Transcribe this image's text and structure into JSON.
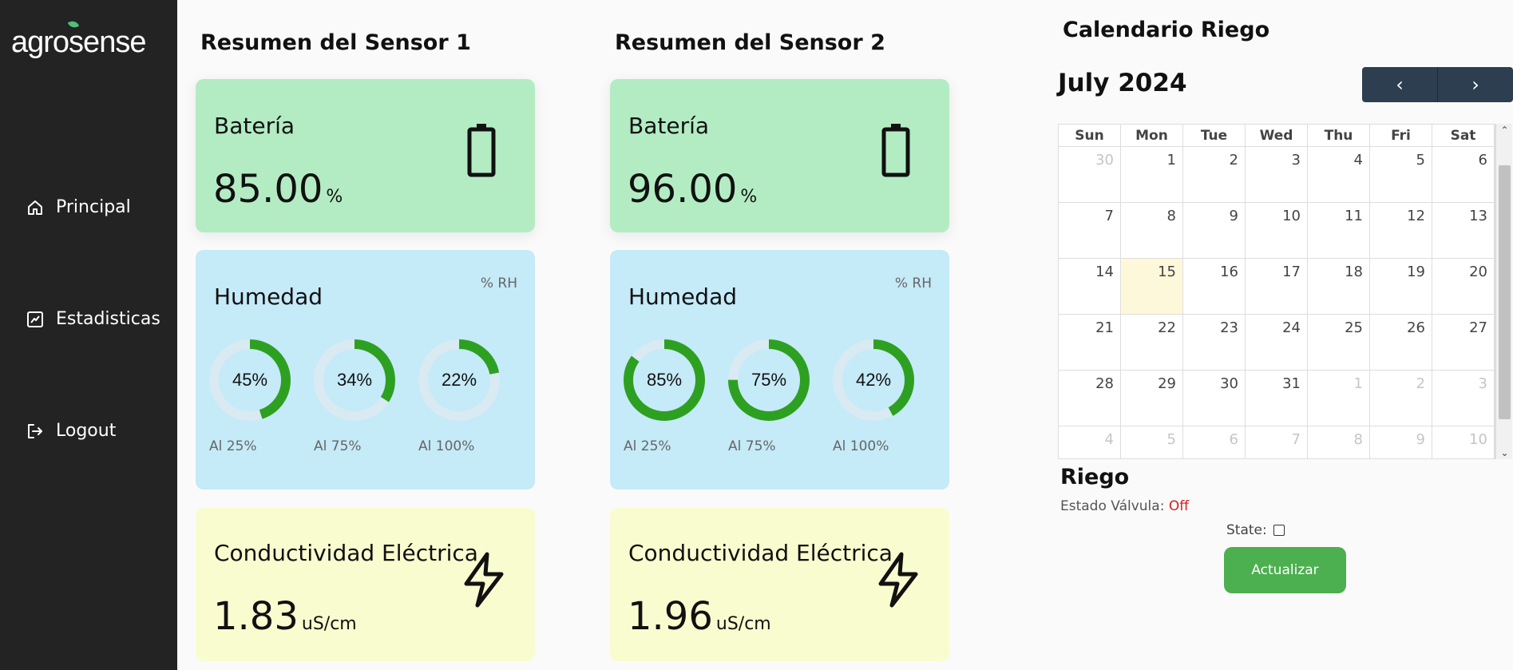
{
  "app": {
    "logo_text": "agrosense"
  },
  "sidebar": {
    "items": [
      {
        "label": "Principal",
        "icon": "home-icon"
      },
      {
        "label": "Estadisticas",
        "icon": "chart-icon"
      },
      {
        "label": "Logout",
        "icon": "logout-icon"
      }
    ]
  },
  "sensors": [
    {
      "title": "Resumen del Sensor 1",
      "battery": {
        "label": "Batería",
        "value": "85.00",
        "unit": "%"
      },
      "humidity": {
        "label": "Humedad",
        "unit": "% RH",
        "gauges": [
          {
            "percent": 45,
            "text": "45%",
            "caption": "Al 25%"
          },
          {
            "percent": 34,
            "text": "34%",
            "caption": "Al 75%"
          },
          {
            "percent": 22,
            "text": "22%",
            "caption": "Al 100%"
          }
        ]
      },
      "conductivity": {
        "label": "Conductividad Eléctrica",
        "value": "1.83",
        "unit": "uS/cm"
      }
    },
    {
      "title": "Resumen del Sensor 2",
      "battery": {
        "label": "Batería",
        "value": "96.00",
        "unit": "%"
      },
      "humidity": {
        "label": "Humedad",
        "unit": "% RH",
        "gauges": [
          {
            "percent": 85,
            "text": "85%",
            "caption": "Al 25%"
          },
          {
            "percent": 75,
            "text": "75%",
            "caption": "Al 75%"
          },
          {
            "percent": 42,
            "text": "42%",
            "caption": "Al 100%"
          }
        ]
      },
      "conductivity": {
        "label": "Conductividad Eléctrica",
        "value": "1.96",
        "unit": "uS/cm"
      }
    }
  ],
  "calendar": {
    "title": "Calendario Riego",
    "month_label": "July 2024",
    "prev_label": "‹",
    "next_label": "›",
    "weekdays": [
      "Sun",
      "Mon",
      "Tue",
      "Wed",
      "Thu",
      "Fri",
      "Sat"
    ],
    "weeks": [
      [
        {
          "d": "30",
          "o": true
        },
        {
          "d": "1"
        },
        {
          "d": "2"
        },
        {
          "d": "3"
        },
        {
          "d": "4"
        },
        {
          "d": "5"
        },
        {
          "d": "6"
        }
      ],
      [
        {
          "d": "7"
        },
        {
          "d": "8"
        },
        {
          "d": "9"
        },
        {
          "d": "10"
        },
        {
          "d": "11"
        },
        {
          "d": "12"
        },
        {
          "d": "13"
        }
      ],
      [
        {
          "d": "14"
        },
        {
          "d": "15",
          "today": true
        },
        {
          "d": "16"
        },
        {
          "d": "17"
        },
        {
          "d": "18"
        },
        {
          "d": "19"
        },
        {
          "d": "20"
        }
      ],
      [
        {
          "d": "21"
        },
        {
          "d": "22"
        },
        {
          "d": "23"
        },
        {
          "d": "24"
        },
        {
          "d": "25"
        },
        {
          "d": "26"
        },
        {
          "d": "27"
        }
      ],
      [
        {
          "d": "28"
        },
        {
          "d": "29"
        },
        {
          "d": "30"
        },
        {
          "d": "31"
        },
        {
          "d": "1",
          "o": true
        },
        {
          "d": "2",
          "o": true
        },
        {
          "d": "3",
          "o": true
        }
      ],
      [
        {
          "d": "4",
          "o": true
        },
        {
          "d": "5",
          "o": true
        },
        {
          "d": "6",
          "o": true
        },
        {
          "d": "7",
          "o": true
        },
        {
          "d": "8",
          "o": true
        },
        {
          "d": "9",
          "o": true
        },
        {
          "d": "10",
          "o": true
        }
      ]
    ]
  },
  "riego": {
    "title": "Riego",
    "estado_label": "Estado Válvula: ",
    "estado_value": "Off",
    "state_label": "State:",
    "state_checked": false,
    "button_label": "Actualizar"
  },
  "colors": {
    "gauge_fill": "#2ea021",
    "gauge_track": "#d9eaf2",
    "valve_off": "#d21d1d",
    "button": "#4caf50"
  }
}
